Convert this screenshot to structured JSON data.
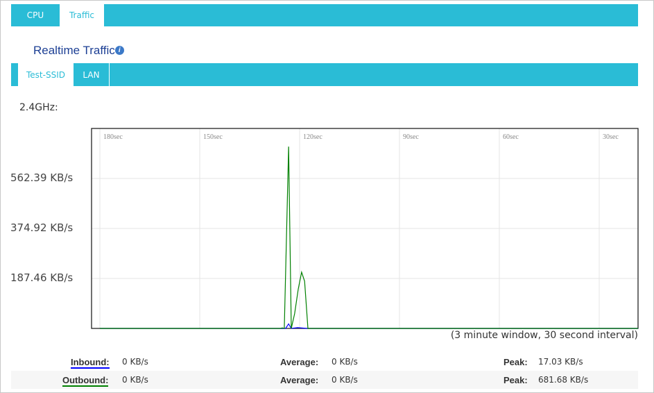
{
  "tabs": [
    {
      "label": "CPU",
      "active": false
    },
    {
      "label": "Traffic",
      "active": true
    }
  ],
  "title": "Realtime Traffic",
  "info_icon": "info-icon",
  "subtabs": [
    {
      "label": "Test-SSID",
      "active": true
    },
    {
      "label": "LAN",
      "active": false
    }
  ],
  "band": "2.4GHz:",
  "colors": {
    "accent": "#2abcd6",
    "inbound": "#0000ff",
    "outbound": "#008000",
    "title": "#1c3f94"
  },
  "chart_data": {
    "type": "line",
    "x_ticks": [
      "180sec",
      "150sec",
      "120sec",
      "90sec",
      "60sec",
      "30sec"
    ],
    "x_tick_values": [
      180,
      150,
      120,
      90,
      60,
      30
    ],
    "y_ticks": [
      "562.39 KB/s",
      "374.92 KB/s",
      "187.46 KB/s"
    ],
    "y_tick_values": [
      562.39,
      374.92,
      187.46
    ],
    "xlim": [
      180,
      18.3
    ],
    "ylim": [
      0,
      749.85
    ],
    "grid": true,
    "caption": "(3 minute window, 30 second interval)",
    "series": [
      {
        "name": "Inbound",
        "color": "#0000ff",
        "points": [
          [
            180,
            0
          ],
          [
            126.2,
            0
          ],
          [
            124.2,
            0
          ],
          [
            123.3,
            17.03
          ],
          [
            122.5,
            0
          ],
          [
            120.6,
            3
          ],
          [
            117.7,
            0
          ],
          [
            18.3,
            0
          ]
        ]
      },
      {
        "name": "Outbound",
        "color": "#008000",
        "points": [
          [
            180,
            0
          ],
          [
            125.8,
            0
          ],
          [
            125.2,
            2
          ],
          [
            124.6,
            0
          ],
          [
            123.3,
            681.68
          ],
          [
            122.5,
            0
          ],
          [
            121.5,
            55
          ],
          [
            120.4,
            148
          ],
          [
            119.4,
            211
          ],
          [
            118.5,
            177
          ],
          [
            117.5,
            0
          ],
          [
            18.3,
            0
          ]
        ]
      }
    ]
  },
  "stats": [
    {
      "label": "Inbound:",
      "current": "0 KB/s",
      "avg_label": "Average:",
      "average": "0 KB/s",
      "peak_label": "Peak:",
      "peak": "17.03 KB/s"
    },
    {
      "label": "Outbound:",
      "current": "0 KB/s",
      "avg_label": "Average:",
      "average": "0 KB/s",
      "peak_label": "Peak:",
      "peak": "681.68 KB/s"
    }
  ]
}
